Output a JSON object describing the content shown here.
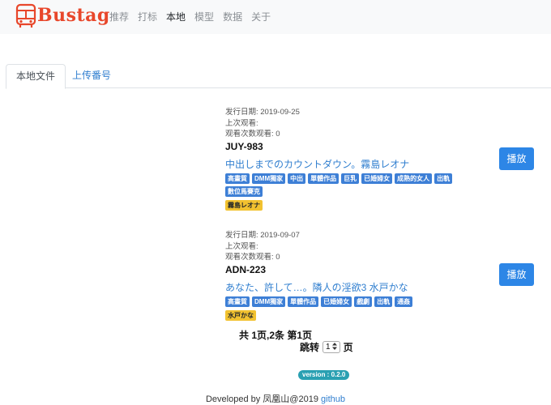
{
  "brand": {
    "name": "Bustag",
    "logo_icon": "bus-icon",
    "color": "#e8472b"
  },
  "nav": [
    {
      "label": "推荐"
    },
    {
      "label": "打标"
    },
    {
      "label": "本地",
      "active": true
    },
    {
      "label": "模型"
    },
    {
      "label": "数据"
    },
    {
      "label": "关于"
    }
  ],
  "tabs": [
    {
      "label": "本地文件",
      "active": true
    },
    {
      "label": "上传番号"
    }
  ],
  "items": [
    {
      "release": "发行日期: 2019-09-25",
      "last_watched": "上次观看:",
      "watch_count": "观看次数观看: 0",
      "code": "JUY-983",
      "title": "中出しまでのカウントダウン。霧島レオナ",
      "tags": [
        "高畫質",
        "DMM獨家",
        "中出",
        "單體作品",
        "巨乳",
        "已婚婦女",
        "成熟的女人",
        "出軌",
        "數位馬賽克"
      ],
      "stars": [
        "霧島レオナ"
      ],
      "play_label": "播放"
    },
    {
      "release": "发行日期: 2019-09-07",
      "last_watched": "上次观看:",
      "watch_count": "观看次数观看: 0",
      "code": "ADN-223",
      "title": "あなた、許して…。隣人の淫欲3 水戸かな",
      "tags": [
        "高畫質",
        "DMM獨家",
        "單體作品",
        "已婚婦女",
        "戲劇",
        "出軌",
        "通姦"
      ],
      "stars": [
        "水戸かな"
      ],
      "play_label": "播放"
    }
  ],
  "pagination": {
    "summary": "共 1页,2条 第1页",
    "jump_prefix": "跳转",
    "page_value": "1",
    "jump_suffix": "页"
  },
  "version": "version : 0.2.0",
  "footer": {
    "text": "Developed by 凤凰山@2019",
    "link": "github"
  },
  "colors": {
    "accent": "#2d86e6",
    "tag": "#3d7fd6",
    "star_tag": "#f2c230",
    "version_badge": "#2aa0b2"
  }
}
